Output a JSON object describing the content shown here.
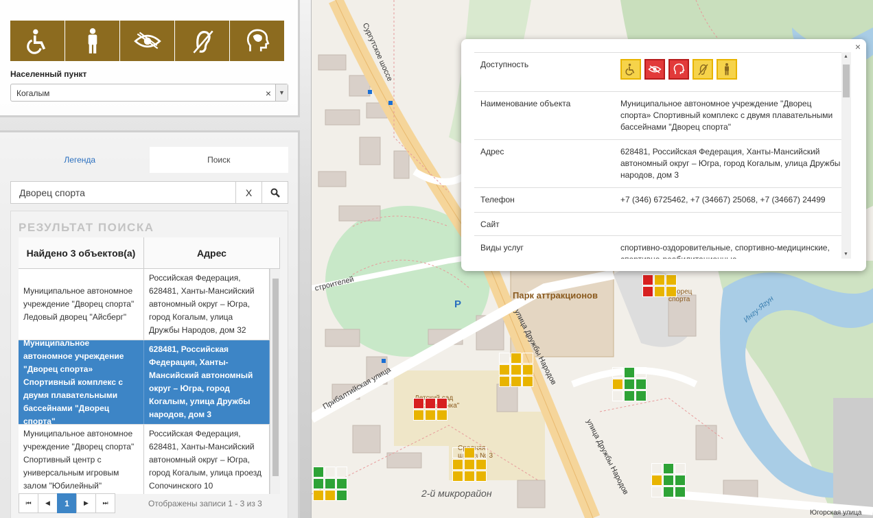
{
  "accessibility_buttons": [
    "wheelchair-icon",
    "person-icon",
    "eye-crossed-icon",
    "ear-crossed-icon",
    "head-mind-icon"
  ],
  "locality": {
    "label": "Населенный пункт",
    "value": "Когалым",
    "clear": "×",
    "arrow": "▼"
  },
  "tabs": {
    "legend": "Легенда",
    "search": "Поиск"
  },
  "search": {
    "value": "Дворец спорта",
    "clear_label": "X",
    "go_icon": "search-icon"
  },
  "results": {
    "title": "РЕЗУЛЬТАТ ПОИСКА",
    "col_found": "Найдено 3 объектов(а)",
    "col_address": "Адрес",
    "rows": [
      {
        "name": "Муниципальное автономное учреждение \"Дворец спорта\" Ледовый дворец \"Айсберг\"",
        "address": "Российская Федерация, 628481, Ханты-Мансийский автономный округ – Югра, город Когалым, улица Дружбы Народов, дом 32",
        "selected": false
      },
      {
        "name": "Муниципальное автономное учреждение \"Дворец спорта» Спортивный комплекс с двумя плавательными бассейнами \"Дворец спорта\"",
        "address": "628481, Российская Федерация, Ханты-Мансийский автономный округ – Югра, город Когалым, улица Дружбы народов, дом 3",
        "selected": true
      },
      {
        "name": "Муниципальное автономное учреждение \"Дворец спорта\" Спортивный центр с универсальным игровым залом \"Юбилейный\"",
        "address": "Российская Федерация, 628481, Ханты-Мансийский автономный округ – Югра, город Когалым, улица проезд Сопочинского 10",
        "selected": false
      }
    ],
    "pager": {
      "first": "⏮",
      "prev": "◀",
      "page": "1",
      "next": "▶",
      "last": "⏭",
      "info": "Отображены записи 1 - 3 из 3"
    }
  },
  "map": {
    "labels": {
      "surgut": "Сургутское шоссе",
      "druzhby1": "улица Дружбы Народов",
      "druzhby2": "улица Дружбы Народов",
      "baltic": "Прибалтийская улица",
      "stroiteley": "строителей",
      "park": "Парк аттракционов",
      "microdistrict": "2-й микрорайон",
      "yugorskaya": "Югорская улица",
      "inguyagun": "Ингу-Ягун",
      "parking": "P",
      "kindergarten": "Детский сад \"Дюймовочка\"",
      "school": "Средняя школа № 3",
      "sport_short": "Дворец спорта"
    }
  },
  "popup": {
    "close": "×",
    "rows": [
      {
        "key": "Доступность",
        "value": ""
      },
      {
        "key": "Наименование объекта",
        "value": "Муниципальное автономное учреждение \"Дворец спорта» Спортивный комплекс с двумя плавательными бассейнами \"Дворец спорта\""
      },
      {
        "key": "Адрес",
        "value": "628481, Российская Федерация, Ханты-Мансийский автономный округ – Югра, город Когалым, улица Дружбы народов, дом 3"
      },
      {
        "key": "Телефон",
        "value": "+7 (346) 6725462, +7 (34667) 25068, +7 (34667) 24499"
      },
      {
        "key": "Сайт",
        "value": ""
      },
      {
        "key": "Виды услуг",
        "value": "спортивно-оздоровительные, спортивно-медицинские, спортивно-реабилитационные,"
      }
    ],
    "access_icons": [
      {
        "icon": "wheelchair-icon",
        "status": "yellow"
      },
      {
        "icon": "eye-crossed-icon",
        "status": "red"
      },
      {
        "icon": "head-mind-icon",
        "status": "red"
      },
      {
        "icon": "ear-crossed-icon",
        "status": "yellow"
      },
      {
        "icon": "person-icon",
        "status": "yellow"
      }
    ]
  },
  "colors": {
    "accent": "#3d85c6",
    "access_brown": "#8c6b1f",
    "poi_yellow": "#e8b400",
    "poi_green": "#2ea336",
    "poi_red": "#d72020"
  }
}
